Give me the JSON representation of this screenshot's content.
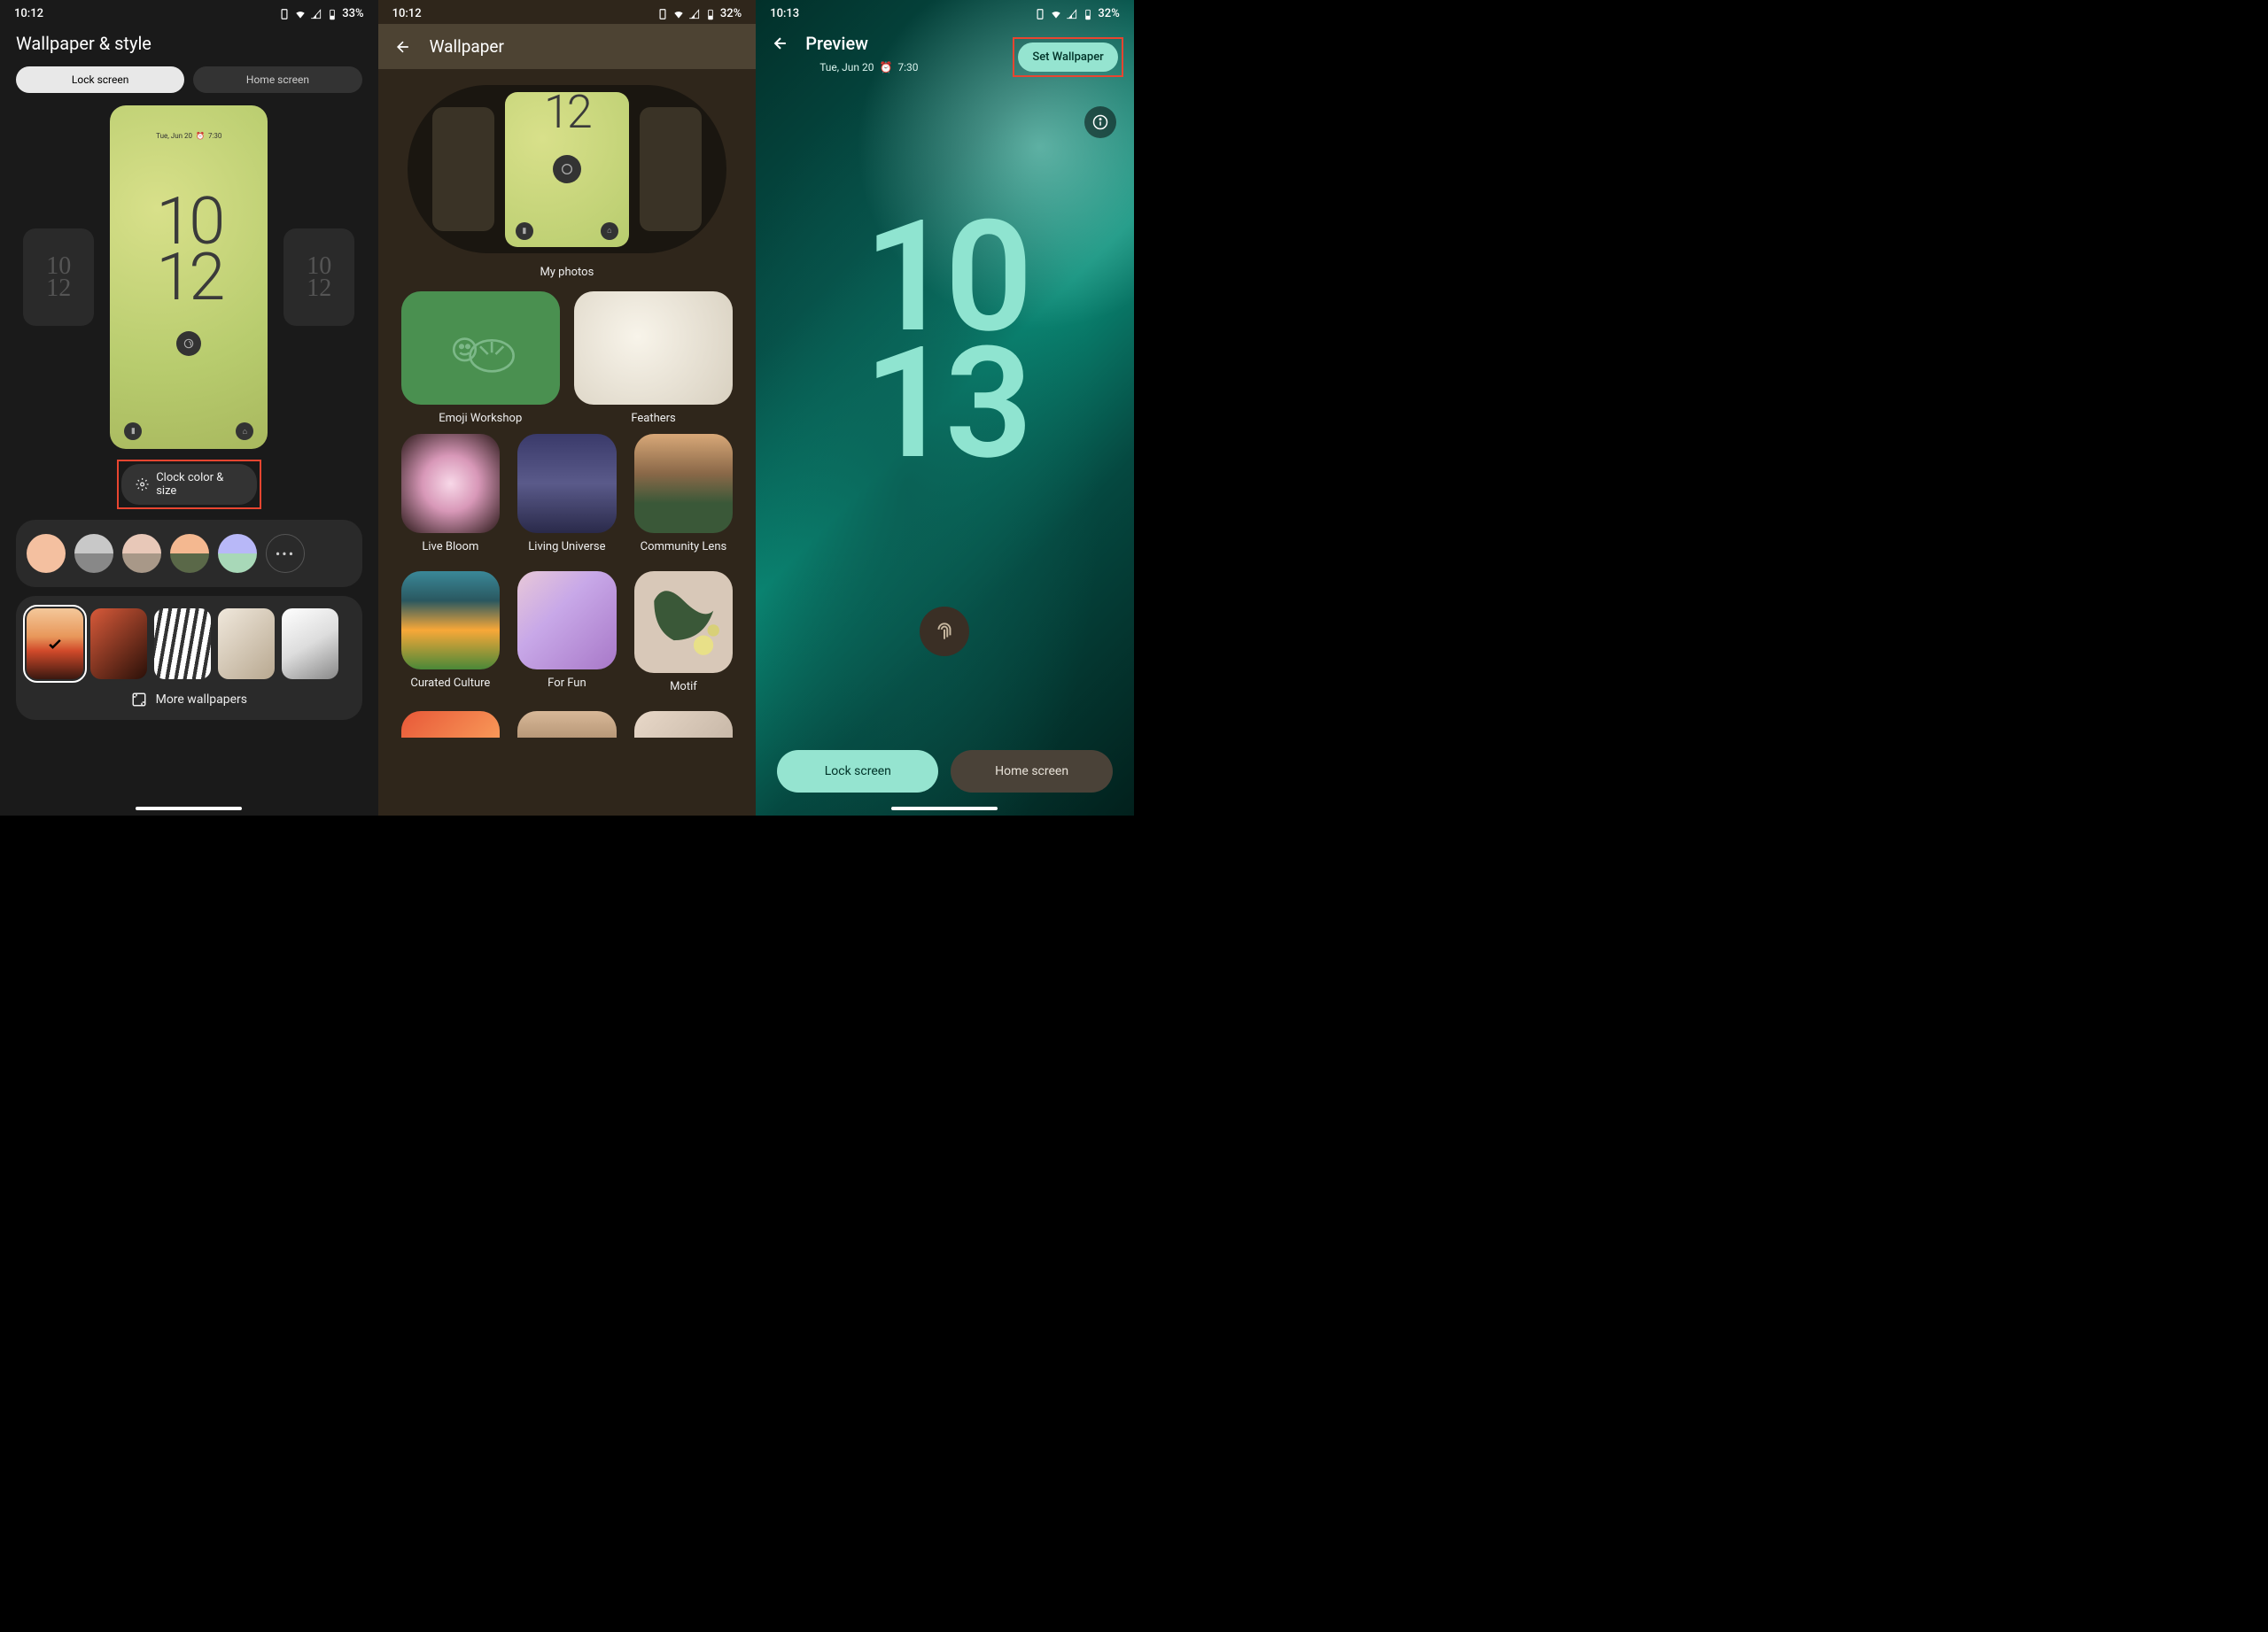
{
  "phone1": {
    "status": {
      "time": "10:12",
      "battery": "33%"
    },
    "title": "Wallpaper & style",
    "tabs": {
      "lock": "Lock screen",
      "home": "Home screen"
    },
    "preview": {
      "date": "Tue, Jun 20",
      "alarm": "7:30",
      "clock_line1": "10",
      "clock_line2": "12"
    },
    "side_clock": {
      "line1": "10",
      "line2": "12"
    },
    "clock_button": "Clock color & size",
    "colors": [
      {
        "top": "#f4c0a0",
        "bottom": "#f4c0a0"
      },
      {
        "top": "#c8c8c8",
        "bottom": "#888888"
      },
      {
        "top": "#e8c8b8",
        "bottom": "#a89888"
      },
      {
        "top": "#f4b890",
        "bottom": "#5a6848"
      },
      {
        "top": "#b8b8f8",
        "bottom": "#a8d8b8"
      }
    ],
    "more_wallpapers": "More wallpapers"
  },
  "phone2": {
    "status": {
      "time": "10:12",
      "battery": "32%"
    },
    "title": "Wallpaper",
    "my_photos": "My photos",
    "preview_clock": "12",
    "categories_2col": [
      {
        "name": "Emoji Workshop",
        "thumb": "th-emoji"
      },
      {
        "name": "Feathers",
        "thumb": "th-feathers"
      }
    ],
    "categories_3col": [
      {
        "name": "Live Bloom",
        "thumb": "th-bloom"
      },
      {
        "name": "Living Universe",
        "thumb": "th-universe"
      },
      {
        "name": "Community Lens",
        "thumb": "th-community"
      },
      {
        "name": "Curated Culture",
        "thumb": "th-culture"
      },
      {
        "name": "For Fun",
        "thumb": "th-forfun"
      },
      {
        "name": "Motif",
        "thumb": "th-motif"
      }
    ]
  },
  "phone3": {
    "status": {
      "time": "10:13",
      "battery": "32%"
    },
    "title": "Preview",
    "set_wallpaper": "Set Wallpaper",
    "date": "Tue, Jun 20",
    "alarm": "7:30",
    "clock_line1": "10",
    "clock_line2": "13",
    "tabs": {
      "lock": "Lock screen",
      "home": "Home screen"
    }
  }
}
